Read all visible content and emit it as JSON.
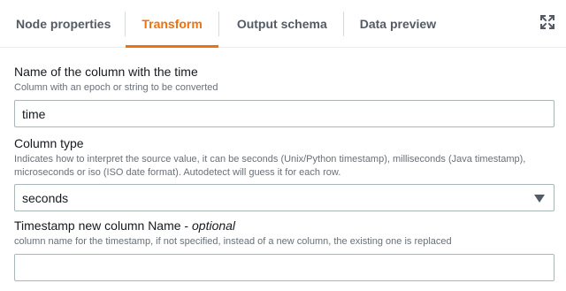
{
  "tabs": [
    {
      "label": "Node properties",
      "active": false
    },
    {
      "label": "Transform",
      "active": true
    },
    {
      "label": "Output schema",
      "active": false
    },
    {
      "label": "Data preview",
      "active": false
    }
  ],
  "colors": {
    "accent": "#ec7211",
    "text": "#16191f",
    "muted": "#687078",
    "border": "#aab7b8"
  },
  "expand_icon": "expand-icon",
  "fields": {
    "time_column": {
      "label": "Name of the column with the time",
      "description": "Column with an epoch or string to be converted",
      "value": "time"
    },
    "column_type": {
      "label": "Column type",
      "description_line1": "Indicates how to interpret the source value, it can be seconds (Unix/Python timestamp), milliseconds (Java timestamp),",
      "description_line2": "microseconds or iso (ISO date format). Autodetect will guess it for each row.",
      "selected": "seconds"
    },
    "new_column": {
      "label": "Timestamp new column Name",
      "label_separator": " - ",
      "optional": "optional",
      "description": "column name for the timestamp, if not specified, instead of a new column, the existing one is replaced",
      "value": ""
    }
  }
}
